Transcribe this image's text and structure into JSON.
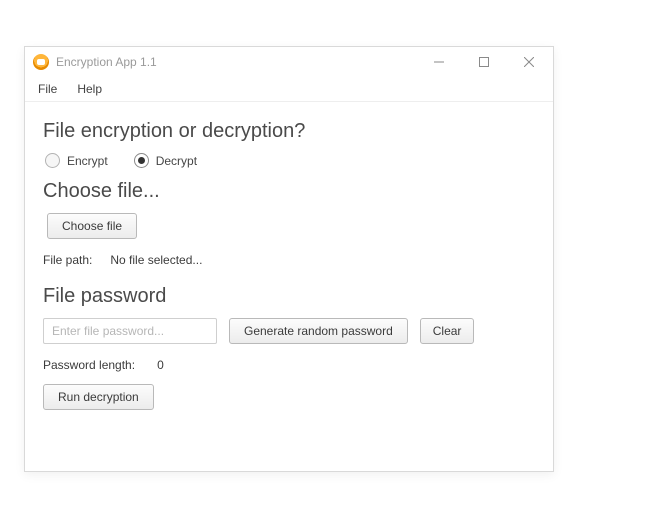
{
  "window": {
    "title": "Encryption App 1.1"
  },
  "menubar": {
    "file": "File",
    "help": "Help"
  },
  "sections": {
    "mode": {
      "heading": "File encryption or decryption?",
      "encrypt_label": "Encrypt",
      "decrypt_label": "Decrypt",
      "selected": "decrypt"
    },
    "file": {
      "heading": "Choose file...",
      "choose_btn": "Choose file",
      "path_label": "File path:",
      "path_value": "No file selected..."
    },
    "password": {
      "heading": "File password",
      "placeholder": "Enter file password...",
      "generate_btn": "Generate random password",
      "clear_btn": "Clear",
      "length_label": "Password length:",
      "length_value": "0",
      "run_btn": "Run decryption"
    }
  }
}
